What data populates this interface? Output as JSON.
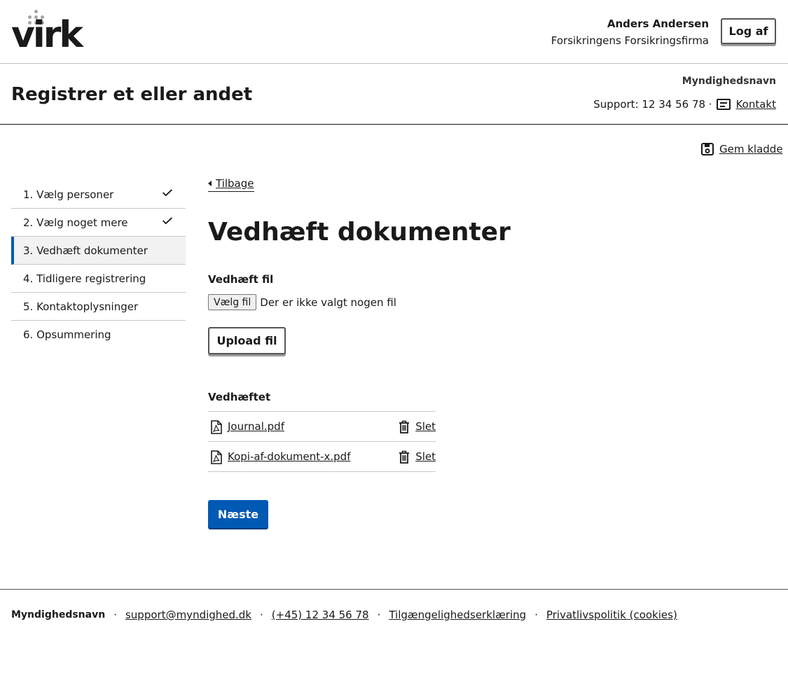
{
  "header": {
    "logo_text": "virk",
    "user_name": "Anders Andersen",
    "user_org": "Forsikringens Forsikringsfirma",
    "logout_label": "Log af"
  },
  "subheader": {
    "service_title": "Registrer et eller andet",
    "authority_name": "Myndighedsnavn",
    "support_text": "Support: 12 34 56 78 ·",
    "contact_label": "Kontakt"
  },
  "save_draft_label": "Gem kladde",
  "steps": [
    {
      "label": "1. Vælg personer",
      "done": true
    },
    {
      "label": "2. Vælg noget mere",
      "done": true
    },
    {
      "label": "3. Vedhæft dokumenter",
      "current": true
    },
    {
      "label": "4. Tidligere registrering"
    },
    {
      "label": "5. Kontaktoplysninger"
    },
    {
      "label": "6. Opsummering"
    }
  ],
  "main": {
    "back_label": "Tilbage",
    "title": "Vedhæft dokumenter",
    "attach_label": "Vedhæft fil",
    "choose_file_label": "Vælg fil",
    "no_file_text": "Der er ikke valgt nogen fil",
    "upload_label": "Upload fil",
    "attached_heading": "Vedhæftet",
    "attachments": [
      {
        "name": "Journal.pdf",
        "delete_label": "Slet"
      },
      {
        "name": "Kopi-af-dokument-x.pdf",
        "delete_label": "Slet"
      }
    ],
    "next_label": "Næste"
  },
  "footer": {
    "authority": "Myndighedsnavn",
    "email": "support@myndighed.dk",
    "phone": "(+45) 12 34 56 78",
    "accessibility": "Tilgængelighedserklæring",
    "privacy": "Privatlivspolitik (cookies)"
  },
  "colors": {
    "primary": "#0059b3",
    "current_step_bg": "#f2f2f2",
    "logo_dots": "#a6a6a6"
  }
}
